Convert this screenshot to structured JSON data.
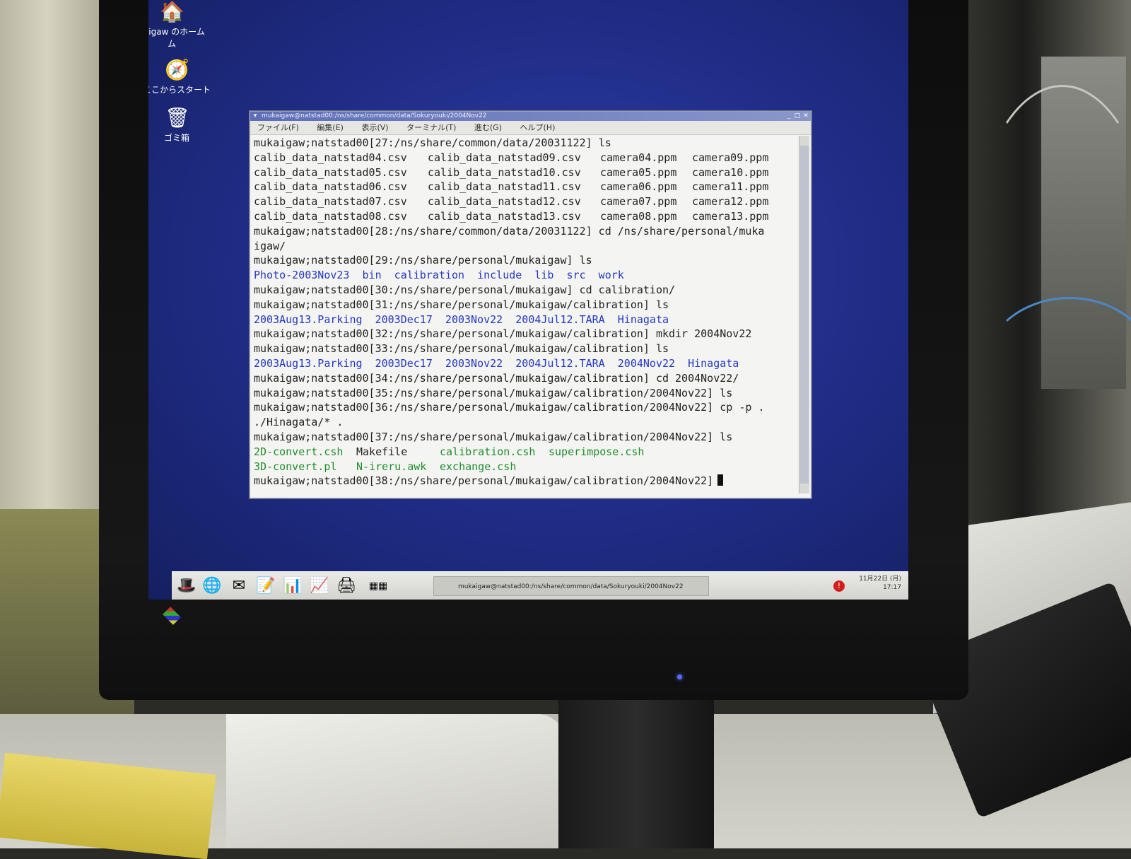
{
  "desktop": {
    "icons": [
      {
        "label": "kaigaw のホーム",
        "label2": "ム",
        "icon": "home-folder-icon"
      },
      {
        "label": "ここからスタート",
        "icon": "start-here-icon"
      },
      {
        "label": "ゴミ箱",
        "icon": "trash-icon"
      }
    ]
  },
  "terminal": {
    "title": "mukaigaw@natstad00:/ns/share/common/data/Sokuryouki/2004Nov22",
    "menu": [
      "ファイル(F)",
      "編集(E)",
      "表示(V)",
      "ターミナル(T)",
      "進む(G)",
      "ヘルプ(H)"
    ],
    "lines": [
      {
        "text": "mukaigaw;natstad00[27:/ns/share/common/data/20031122] ls"
      },
      {
        "cols": [
          "calib_data_natstad04.csv",
          "calib_data_natstad09.csv",
          "camera04.ppm",
          "camera09.ppm"
        ]
      },
      {
        "cols": [
          "calib_data_natstad05.csv",
          "calib_data_natstad10.csv",
          "camera05.ppm",
          "camera10.ppm"
        ]
      },
      {
        "cols": [
          "calib_data_natstad06.csv",
          "calib_data_natstad11.csv",
          "camera06.ppm",
          "camera11.ppm"
        ]
      },
      {
        "cols": [
          "calib_data_natstad07.csv",
          "calib_data_natstad12.csv",
          "camera07.ppm",
          "camera12.ppm"
        ]
      },
      {
        "cols": [
          "calib_data_natstad08.csv",
          "calib_data_natstad13.csv",
          "camera08.ppm",
          "camera13.ppm"
        ]
      },
      {
        "text": "mukaigaw;natstad00[28:/ns/share/common/data/20031122] cd /ns/share/personal/muka"
      },
      {
        "text": "igaw/"
      },
      {
        "text": "mukaigaw;natstad00[29:/ns/share/personal/mukaigaw] ls"
      },
      {
        "text": "Photo-2003Nov23  bin  calibration  include  lib  src  work",
        "color": "blue"
      },
      {
        "text": "mukaigaw;natstad00[30:/ns/share/personal/mukaigaw] cd calibration/"
      },
      {
        "text": "mukaigaw;natstad00[31:/ns/share/personal/mukaigaw/calibration] ls"
      },
      {
        "text": "2003Aug13.Parking  2003Dec17  2003Nov22  2004Jul12.TARA  Hinagata",
        "color": "blue"
      },
      {
        "text": "mukaigaw;natstad00[32:/ns/share/personal/mukaigaw/calibration] mkdir 2004Nov22"
      },
      {
        "text": "mukaigaw;natstad00[33:/ns/share/personal/mukaigaw/calibration] ls"
      },
      {
        "text": "2003Aug13.Parking  2003Dec17  2003Nov22  2004Jul12.TARA  2004Nov22  Hinagata",
        "color": "blue"
      },
      {
        "text": "mukaigaw;natstad00[34:/ns/share/personal/mukaigaw/calibration] cd 2004Nov22/"
      },
      {
        "text": "mukaigaw;natstad00[35:/ns/share/personal/mukaigaw/calibration/2004Nov22] ls"
      },
      {
        "text": "mukaigaw;natstad00[36:/ns/share/personal/mukaigaw/calibration/2004Nov22] cp -p ."
      },
      {
        "text": "./Hinagata/* ."
      },
      {
        "text": "mukaigaw;natstad00[37:/ns/share/personal/mukaigaw/calibration/2004Nov22] ls"
      },
      {
        "files": [
          {
            "t": "2D-convert.csh",
            "c": "green"
          },
          {
            "t": "Makefile",
            "c": ""
          },
          {
            "t": "calibration.csh",
            "c": "green"
          },
          {
            "t": "superimpose.csh",
            "c": "green"
          }
        ]
      },
      {
        "files": [
          {
            "t": "3D-convert.pl",
            "c": "green"
          },
          {
            "t": "N-ireru.awk",
            "c": "green"
          },
          {
            "t": "exchange.csh",
            "c": "green"
          }
        ]
      },
      {
        "text": "mukaigaw;natstad00[38:/ns/share/personal/mukaigaw/calibration/2004Nov22]",
        "cursor": true
      }
    ]
  },
  "taskbar": {
    "launchers": [
      "redhat-menu-icon",
      "web-browser-icon",
      "mail-icon",
      "office-icon",
      "presentation-icon",
      "chart-icon",
      "printer-icon",
      "workspace-switcher-icon"
    ],
    "task_label": "mukaigaw@natstad00:/ns/share/common/data/Sokuryouki/2004Nov22",
    "clock_date": "11月22日 (月)",
    "clock_time": "17:17"
  }
}
